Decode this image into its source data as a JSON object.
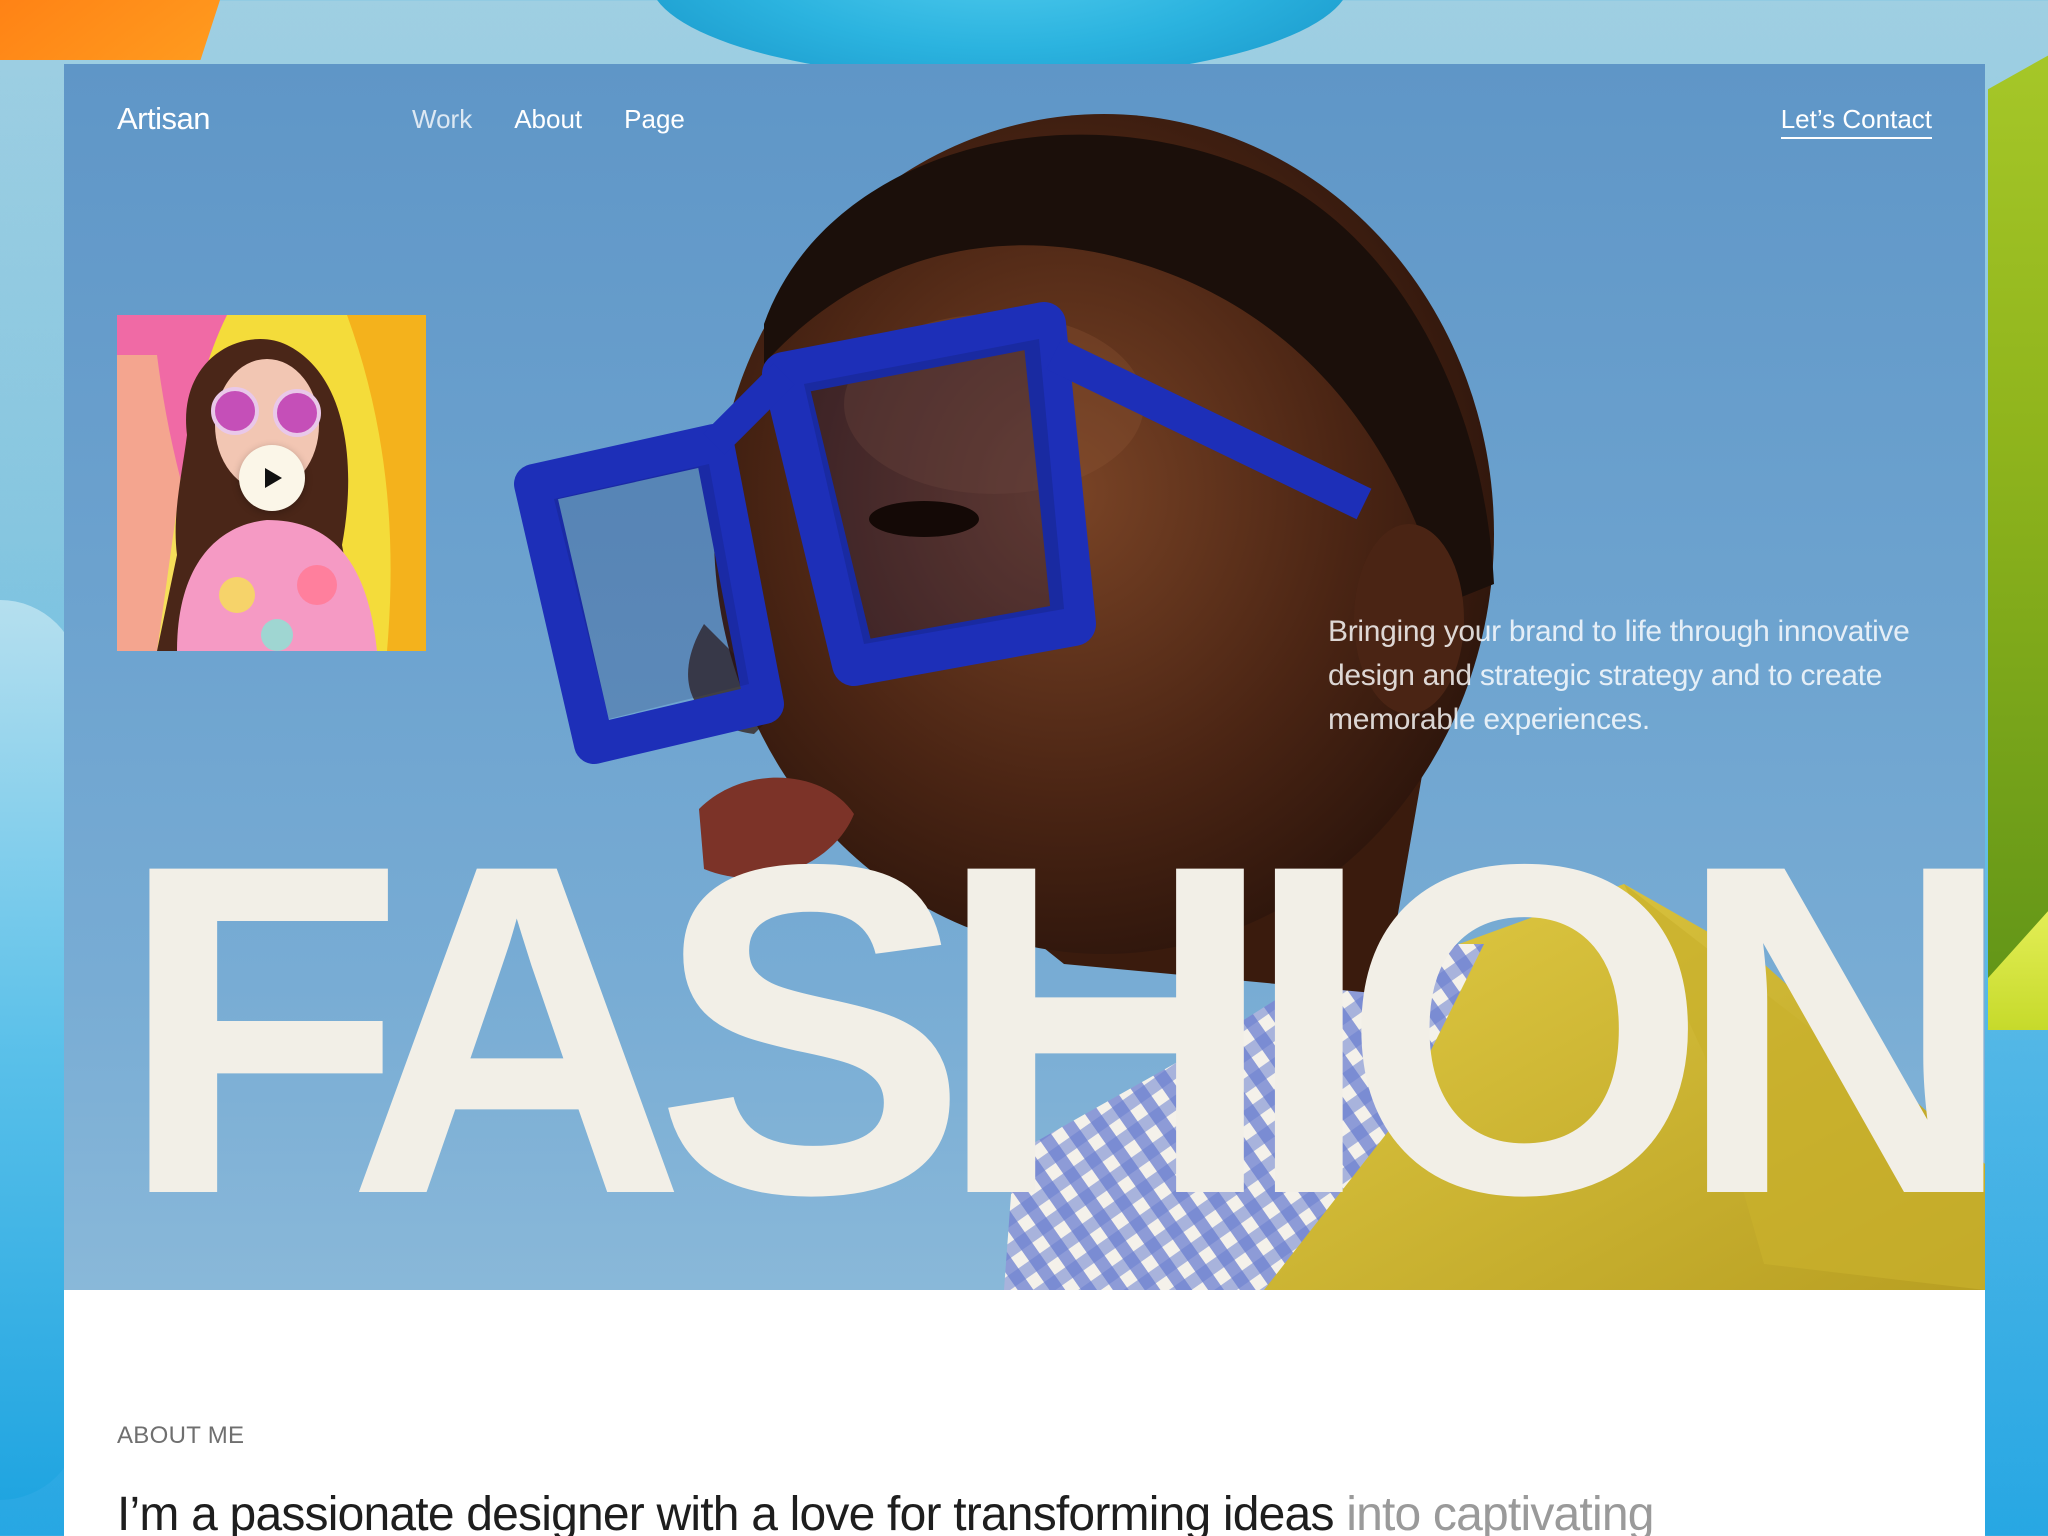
{
  "nav": {
    "logo": "Artisan",
    "links": [
      "Work",
      "About",
      "Page"
    ],
    "cta": "Let’s Contact"
  },
  "hero": {
    "tagline": "Bringing your brand to life through innovative design and strategic  strategy and to create memorable experiences.",
    "headline": "FASHION"
  },
  "about": {
    "kicker": "ABOUT ME",
    "text_strong": "I’m a passionate designer with a love for transforming ideas",
    "text_faded": "into captivating"
  },
  "colors": {
    "sky": "#6da3cf",
    "headline": "#f2efe7",
    "glasses": "#1d2fb8",
    "jacket": "#d8c23a"
  }
}
